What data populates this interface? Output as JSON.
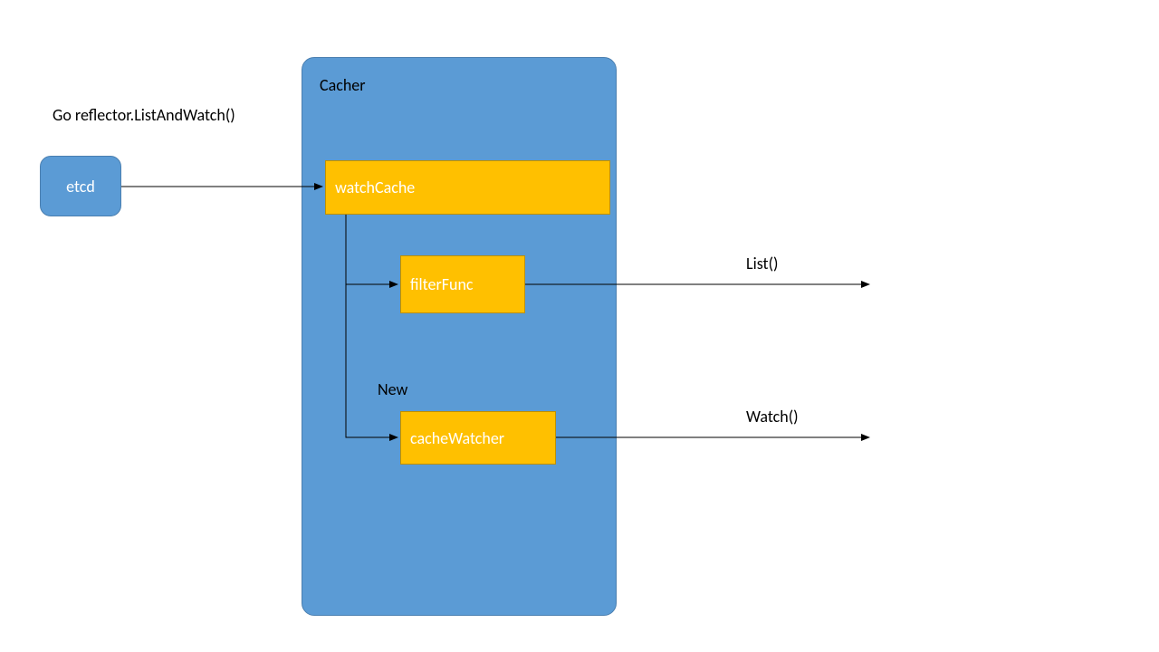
{
  "nodes": {
    "etcd": "etcd",
    "cacher": "Cacher",
    "watchCache": "watchCache",
    "filterFunc": "filterFunc",
    "cacheWatcher": "cacheWatcher"
  },
  "labels": {
    "goReflector": "Go reflector.ListAndWatch()",
    "new": "New",
    "list": "List()",
    "watch": "Watch()"
  },
  "colors": {
    "blue": "#5b9bd5",
    "orange": "#ffc000"
  }
}
